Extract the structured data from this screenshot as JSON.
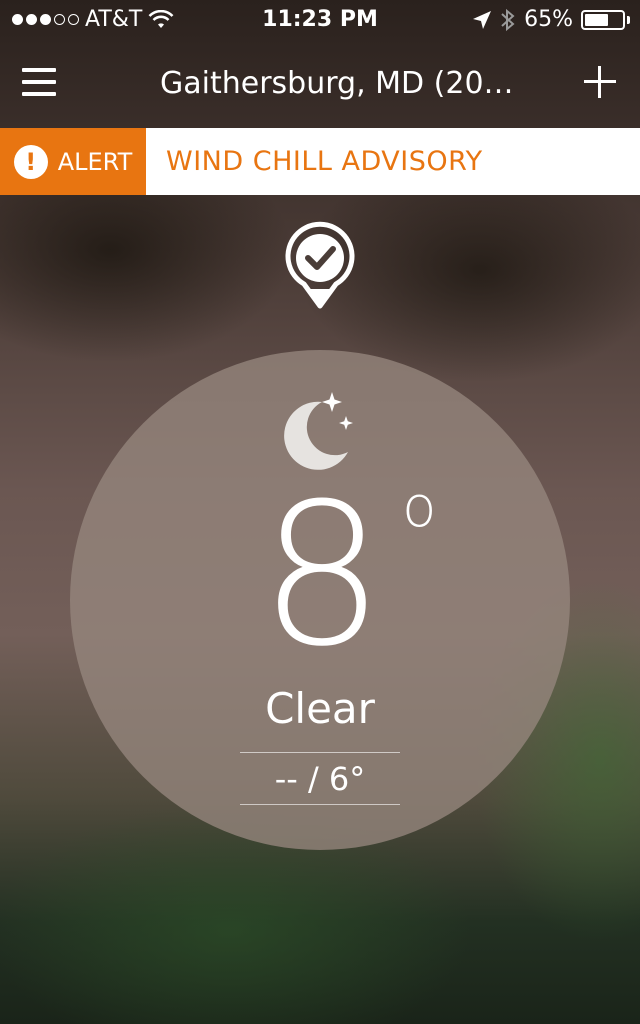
{
  "status_bar": {
    "signal_dots_filled": 3,
    "signal_dots_total": 5,
    "carrier": "AT&T",
    "wifi_icon": "wifi-icon",
    "time": "11:23 PM",
    "location_icon": "location-arrow-icon",
    "bluetooth_icon": "bluetooth-icon",
    "battery_percent": "65%",
    "battery_level": 0.65
  },
  "header": {
    "menu_icon": "hamburger-menu-icon",
    "location": "Gaithersburg, MD (208...",
    "add_icon": "plus-icon"
  },
  "alert": {
    "badge_icon": "exclamation-icon",
    "badge_label": "ALERT",
    "message": "WIND CHILL ADVISORY",
    "color": "#e87511"
  },
  "current": {
    "location_pin_icon": "location-check-pin-icon",
    "condition_icon": "moon-stars-icon",
    "temperature": "8",
    "degree_symbol": "o",
    "condition": "Clear",
    "hi_lo": "-- / 6°"
  }
}
